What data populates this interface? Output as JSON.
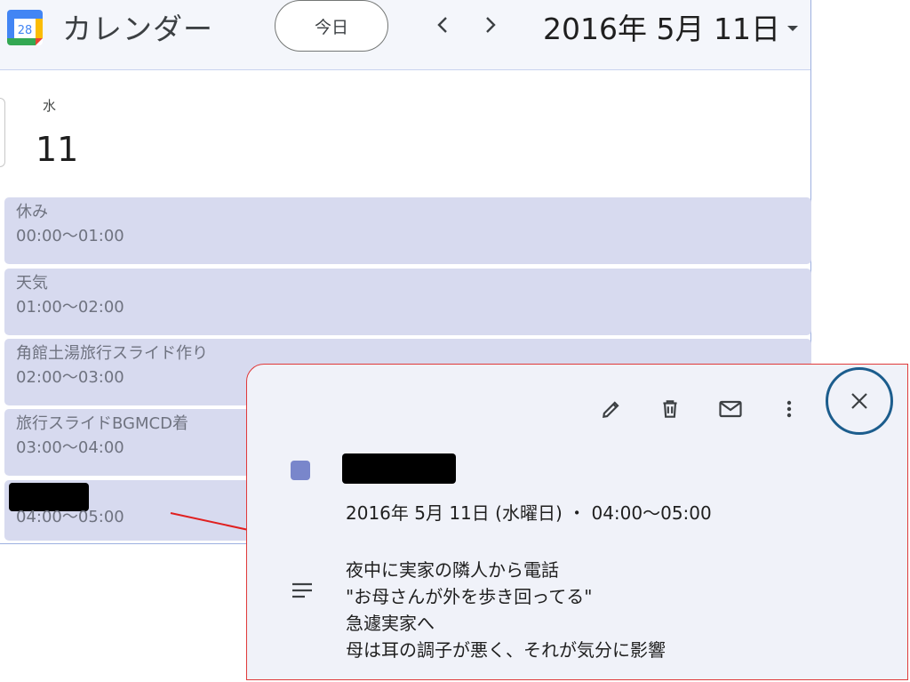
{
  "header": {
    "logo_number": "28",
    "app_title": "カレンダー",
    "today_label": "今日",
    "date_label": "2016年 5月 11日"
  },
  "day": {
    "weekday": "水",
    "number": "11"
  },
  "events": [
    {
      "title": "休み",
      "time": "00:00〜01:00"
    },
    {
      "title": "天気",
      "time": "01:00〜02:00"
    },
    {
      "title": "角館土湯旅行スライド作り",
      "time": "02:00〜03:00"
    },
    {
      "title": "旅行スライドBGMCD着",
      "time": "03:00〜04:00"
    },
    {
      "title": "",
      "time": "04:00〜05:00",
      "redacted": true
    }
  ],
  "popup": {
    "title_redacted": true,
    "datetime": "2016年 5月 11日 (水曜日) ・ 04:00〜05:00",
    "event_color": "#7986cb",
    "description_lines": [
      "夜中に実家の隣人から電話",
      "\"お母さんが外を歩き回ってる\"",
      "急遽実家へ",
      "母は耳の調子が悪く、それが気分に影響"
    ]
  },
  "icons": {
    "edit": "pencil-icon",
    "delete": "trash-icon",
    "email": "mail-icon",
    "more": "more-vert-icon",
    "close": "close-icon",
    "description": "notes-icon"
  },
  "colors": {
    "event_bg": "#d7daef",
    "highlight_border": "#e03a3a",
    "close_circle": "#1c5d8d",
    "arrow": "#e02020"
  }
}
